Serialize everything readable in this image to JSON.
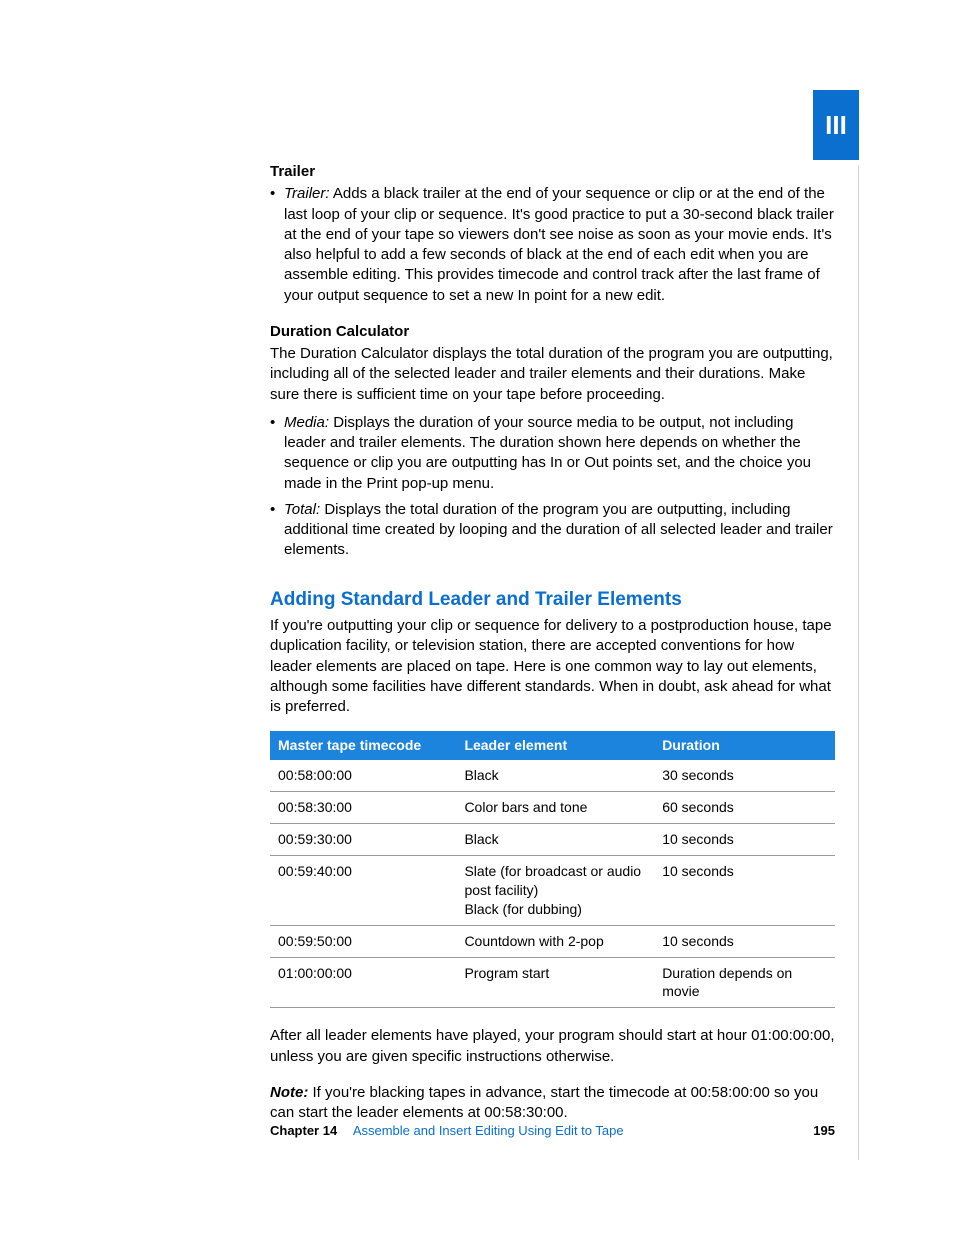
{
  "partBadge": "III",
  "trailer": {
    "heading": "Trailer",
    "items": [
      {
        "term": "Trailer:",
        "text": "Adds a black trailer at the end of your sequence or clip or at the end of the last loop of your clip or sequence. It's good practice to put a 30-second black trailer at the end of your tape so viewers don't see noise as soon as your movie ends. It's also helpful to add a few seconds of black at the end of each edit when you are assemble editing. This provides timecode and control track after the last frame of your output sequence to set a new In point for a new edit."
      }
    ]
  },
  "duration": {
    "heading": "Duration Calculator",
    "intro": "The Duration Calculator displays the total duration of the program you are outputting, including all of the selected leader and trailer elements and their durations. Make sure there is sufficient time on your tape before proceeding.",
    "items": [
      {
        "term": "Media:",
        "text": "Displays the duration of your source media to be output, not including leader and trailer elements. The duration shown here depends on whether the sequence or clip you are outputting has In or Out points set, and the choice you made in the Print pop-up menu."
      },
      {
        "term": "Total:",
        "text": "Displays the total duration of the program you are outputting, including additional time created by looping and the duration of all selected leader and trailer elements."
      }
    ]
  },
  "section": {
    "title": "Adding Standard Leader and Trailer Elements",
    "intro": "If you're outputting your clip or sequence for delivery to a postproduction house, tape duplication facility, or television station, there are accepted conventions for how leader elements are placed on tape. Here is one common way to lay out elements, although some facilities have different standards. When in doubt, ask ahead for what is preferred."
  },
  "table": {
    "headers": [
      "Master tape timecode",
      "Leader element",
      "Duration"
    ],
    "rows": [
      {
        "tc": "00:58:00:00",
        "el": "Black",
        "dur": "30 seconds"
      },
      {
        "tc": "00:58:30:00",
        "el": "Color bars and tone",
        "dur": "60 seconds"
      },
      {
        "tc": "00:59:30:00",
        "el": "Black",
        "dur": "10 seconds"
      },
      {
        "tc": "00:59:40:00",
        "el": "Slate (for broadcast or audio post facility)\nBlack (for dubbing)",
        "dur": "10 seconds"
      },
      {
        "tc": "00:59:50:00",
        "el": "Countdown with 2-pop",
        "dur": "10 seconds"
      },
      {
        "tc": "01:00:00:00",
        "el": "Program start",
        "dur": "Duration depends on movie"
      }
    ]
  },
  "afterTable": "After all leader elements have played, your program should start at hour 01:00:00:00, unless you are given specific instructions otherwise.",
  "note": {
    "label": "Note:",
    "text": "If you're blacking tapes in advance, start the timecode at 00:58:00:00 so you can start the leader elements at 00:58:30:00."
  },
  "footer": {
    "chapterLabel": "Chapter 14",
    "chapterTitle": "Assemble and Insert Editing Using Edit to Tape",
    "page": "195"
  }
}
